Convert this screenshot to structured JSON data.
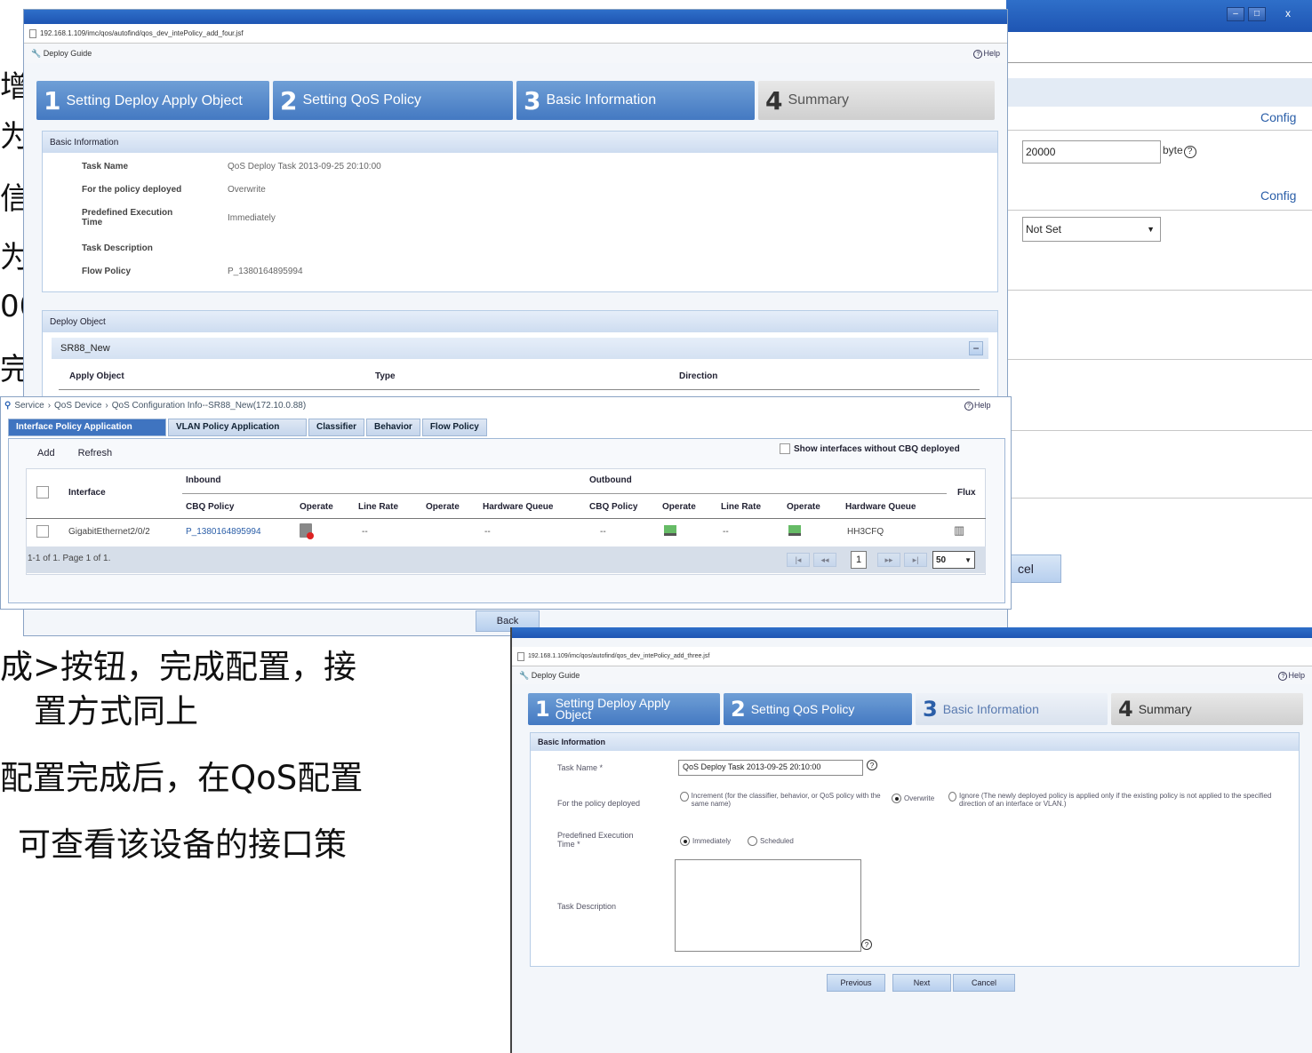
{
  "slide_text": {
    "left_fragments": [
      "增",
      "为",
      "信",
      "为",
      "00",
      "完"
    ],
    "bottom_lines": [
      "成>按钮，完成配置，接",
      "置方式同上",
      "配置完成后，在QoS配置",
      "可查看该设备的接口策"
    ]
  },
  "summary_window": {
    "address": "192.168.1.109/imc/qos/autofind/qos_dev_intePolicy_add_four.jsf",
    "guide_label": "Deploy Guide",
    "help": "Help",
    "steps": [
      {
        "num": "1",
        "label": "Setting Deploy Apply Object"
      },
      {
        "num": "2",
        "label": "Setting QoS Policy"
      },
      {
        "num": "3",
        "label": "Basic Information"
      },
      {
        "num": "4",
        "label": "Summary"
      }
    ],
    "basic_info": {
      "title": "Basic Information",
      "rows": [
        {
          "label": "Task Name",
          "value": "QoS Deploy Task 2013-09-25 20:10:00"
        },
        {
          "label": "For the policy deployed",
          "value": "Overwrite"
        },
        {
          "label": "Predefined Execution Time",
          "value": "Immediately"
        },
        {
          "label": "Task Description",
          "value": ""
        },
        {
          "label": "Flow Policy",
          "value": "P_1380164895994"
        }
      ]
    },
    "deploy_object": {
      "title": "Deploy Object",
      "group": "SR88_New",
      "collapse": "−",
      "columns": [
        "Apply Object",
        "Type",
        "Direction"
      ]
    },
    "back_button": "Back"
  },
  "bg_window": {
    "config_label_1": "Config",
    "bytes_value": "20000",
    "byte_unit": "byte",
    "config_label_2": "Config",
    "select_value": "Not Set",
    "cancel_partial": "cel"
  },
  "qos_window": {
    "breadcrumb": [
      "Service",
      "QoS Device",
      "QoS Configuration Info--SR88_New(172.10.0.88)"
    ],
    "help": "Help",
    "tabs": [
      "Interface Policy Application",
      "VLAN Policy Application",
      "Classifier",
      "Behavior",
      "Flow Policy"
    ],
    "toolbar": {
      "add": "Add",
      "refresh": "Refresh",
      "show_label": "Show interfaces without CBQ deployed"
    },
    "table": {
      "interface_header": "Interface",
      "inbound": "Inbound",
      "outbound": "Outbound",
      "flux": "Flux",
      "sub_headers": [
        "CBQ Policy",
        "Operate",
        "Line Rate",
        "Operate",
        "Hardware Queue",
        "CBQ Policy",
        "Operate",
        "Line Rate",
        "Operate",
        "Hardware Queue"
      ],
      "rows": [
        {
          "interface": "GigabitEthernet2/0/2",
          "cbq_in": "P_1380164895994",
          "line_rate_in": "--",
          "hw_queue_in": "--",
          "cbq_out": "--",
          "line_rate_out": "--",
          "hw_queue_out": "HH3CFQ"
        }
      ]
    },
    "pager": {
      "summary": "1-1 of 1. Page 1 of 1.",
      "page": "1",
      "page_size": "50"
    }
  },
  "basic_window": {
    "address": "192.168.1.109/imc/qos/autofind/qos_dev_intePolicy_add_three.jsf",
    "guide_label": "Deploy Guide",
    "help": "Help",
    "steps": [
      {
        "num": "1",
        "label": "Setting Deploy Apply Object"
      },
      {
        "num": "2",
        "label": "Setting QoS Policy"
      },
      {
        "num": "3",
        "label": "Basic Information"
      },
      {
        "num": "4",
        "label": "Summary"
      }
    ],
    "panel_title": "Basic Information",
    "task_name_label": "Task Name *",
    "task_name_value": "QoS Deploy Task 2013-09-25 20:10:00",
    "policy_label": "For the policy deployed",
    "opt_increment": "Increment (for the classifier, behavior, or QoS policy with the same name)",
    "opt_overwrite": "Overwrite",
    "opt_ignore": "Ignore (The newly deployed policy is applied only if the existing policy is not applied to the specified direction of an interface or VLAN.)",
    "exec_label": "Predefined Execution Time *",
    "opt_immediately": "Immediately",
    "opt_scheduled": "Scheduled",
    "desc_label": "Task Description",
    "buttons": {
      "previous": "Previous",
      "next": "Next",
      "cancel": "Cancel"
    }
  }
}
